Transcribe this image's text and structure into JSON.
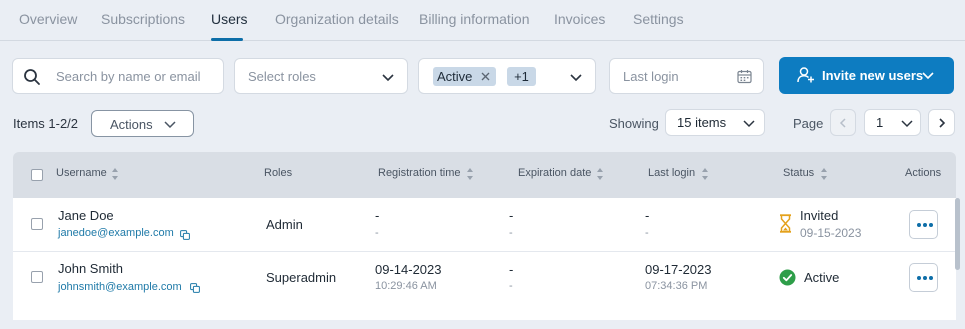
{
  "tabs": [
    "Overview",
    "Subscriptions",
    "Users",
    "Organization details",
    "Billing information",
    "Invoices",
    "Settings"
  ],
  "active_tab": "Users",
  "filters": {
    "search_placeholder": "Search by name or email",
    "roles_placeholder": "Select roles",
    "status_chip": "Active",
    "status_more": "+1",
    "last_login_placeholder": "Last login"
  },
  "invite_label": "Invite new users",
  "toolbar": {
    "items_count": "Items 1-2/2",
    "actions_label": "Actions",
    "showing_label": "Showing",
    "page_size": "15 items",
    "page_label": "Page",
    "page_number": "1"
  },
  "columns": {
    "username": "Username",
    "roles": "Roles",
    "registration": "Registration time",
    "expiration": "Expiration date",
    "last_login": "Last login",
    "status": "Status",
    "actions": "Actions"
  },
  "rows": [
    {
      "name": "Jane Doe",
      "email": "janedoe@example.com",
      "role": "Admin",
      "reg_date": "-",
      "reg_time": "-",
      "exp_date": "-",
      "exp_time": "-",
      "login_date": "-",
      "login_time": "-",
      "status": "Invited",
      "status_date": "09-15-2023",
      "status_icon": "hourglass-icon",
      "status_color": "#e4a11b"
    },
    {
      "name": "John Smith",
      "email": "johnsmith@example.com",
      "role": "Superadmin",
      "reg_date": "09-14-2023",
      "reg_time": "10:29:46 AM",
      "exp_date": "-",
      "exp_time": "-",
      "login_date": "09-17-2023",
      "login_time": "07:34:36 PM",
      "status": "Active",
      "status_date": "",
      "status_icon": "check-circle-icon",
      "status_color": "#2e9e49"
    }
  ],
  "colors": {
    "accent": "#0d7cc1",
    "link": "#1f7aa8"
  }
}
